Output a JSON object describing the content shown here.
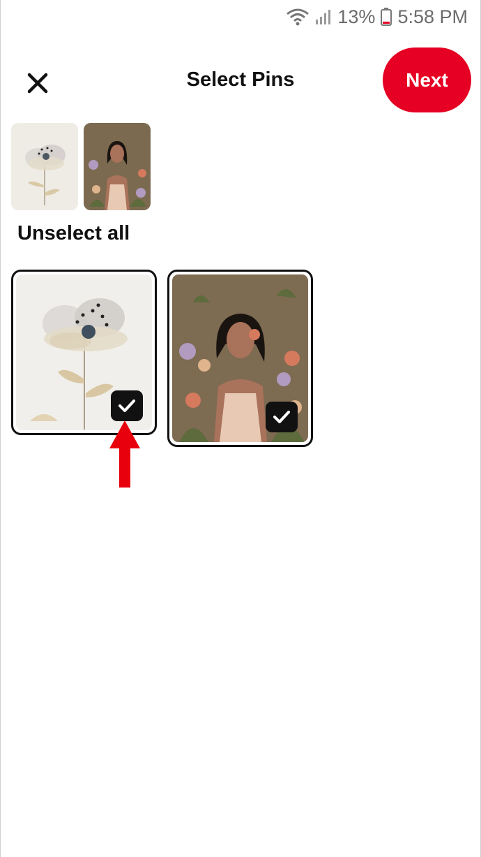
{
  "status_bar": {
    "battery": "13%",
    "time": "5:58 PM",
    "wifi_icon": "wifi-icon",
    "signal_icon": "signal-icon",
    "battery_icon": "battery-icon"
  },
  "header": {
    "title": "Select Pins",
    "close_icon": "close-icon",
    "next_label": "Next"
  },
  "colors": {
    "accent": "#e60023",
    "check_bg": "#111111",
    "annotation_arrow": "#e8000d"
  },
  "selection": {
    "unselect_all_label": "Unselect all",
    "thumbnails": [
      {
        "image": "flower-painting",
        "selected": true
      },
      {
        "image": "woman-flowers-illustration",
        "selected": true
      }
    ]
  },
  "pins": [
    {
      "image": "flower-painting",
      "selected": true,
      "check_icon": "checkmark-icon"
    },
    {
      "image": "woman-flowers-illustration",
      "selected": true,
      "check_icon": "checkmark-icon"
    }
  ]
}
